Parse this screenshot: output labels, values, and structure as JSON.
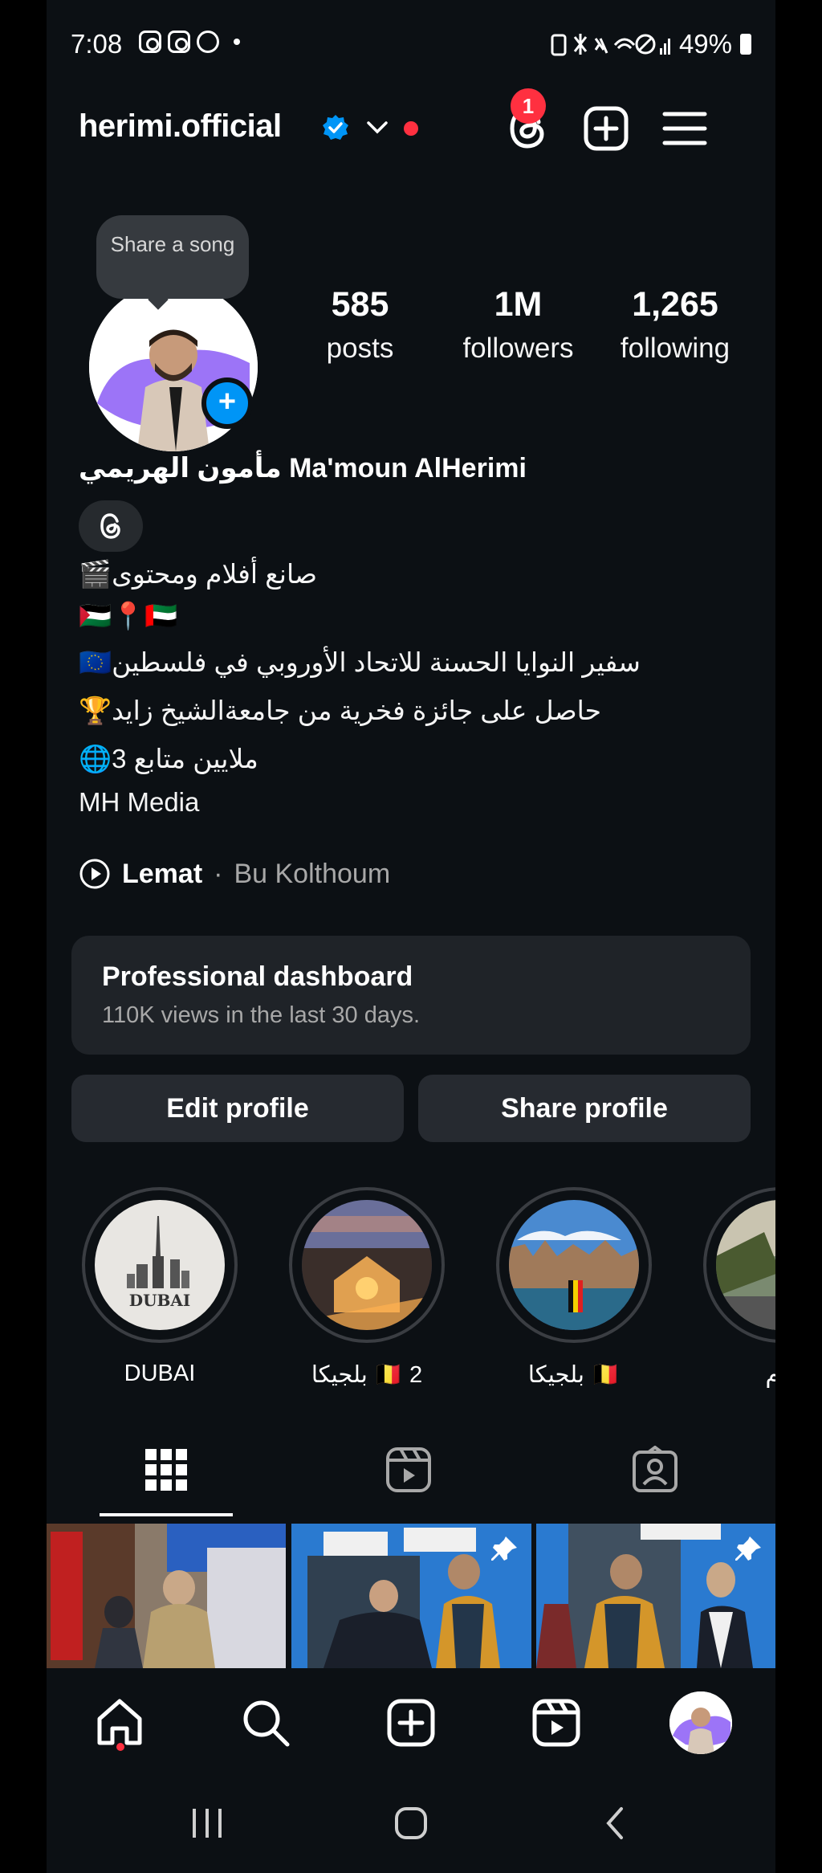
{
  "status_bar": {
    "time": "7:08",
    "battery": "49%"
  },
  "header": {
    "username": "herimi.official",
    "threads_badge": "1"
  },
  "profile": {
    "note_bubble": "Share a song",
    "stats": [
      {
        "value": "585",
        "label": "posts"
      },
      {
        "value": "1M",
        "label": "followers"
      },
      {
        "value": "1,265",
        "label": "following"
      }
    ],
    "full_name": "مأمون الهريمي Ma'moun AlHerimi",
    "bio_lines": [
      "🎬صانع أفلام ومحتوى",
      "🇵🇸📍🇦🇪",
      "🇪🇺سفير النوايا الحسنة للاتحاد الأوروبي في فلسطين",
      "🏆حاصل على جائزة فخرية من جامعةالشيخ زايد",
      "🌐ملايين متابع 3",
      "MH Media"
    ],
    "music": {
      "song": "Lemat",
      "artist": "Bu Kolthoum"
    }
  },
  "dashboard": {
    "title": "Professional dashboard",
    "subtitle": "110K views in the last 30 days."
  },
  "buttons": {
    "edit": "Edit profile",
    "share": "Share profile"
  },
  "highlights": [
    {
      "label": "DUBAI",
      "image_text": "DUBAI"
    },
    {
      "label": "بلجيكا 🇧🇪 2"
    },
    {
      "label": "بلجيكا 🇧🇪"
    },
    {
      "label": "دام"
    }
  ],
  "colors": {
    "background": "#0c1014",
    "accent_blue": "#0095f6",
    "notification_red": "#ff3040",
    "card": "#1f2328",
    "button": "#262a30"
  },
  "icons": {
    "header": [
      "threads-icon",
      "create-icon",
      "menu-icon"
    ],
    "tabs": [
      "grid-icon",
      "reels-icon",
      "tagged-icon"
    ],
    "bottom_nav": [
      "home-icon",
      "search-icon",
      "create-icon",
      "reels-icon",
      "profile-avatar"
    ]
  }
}
